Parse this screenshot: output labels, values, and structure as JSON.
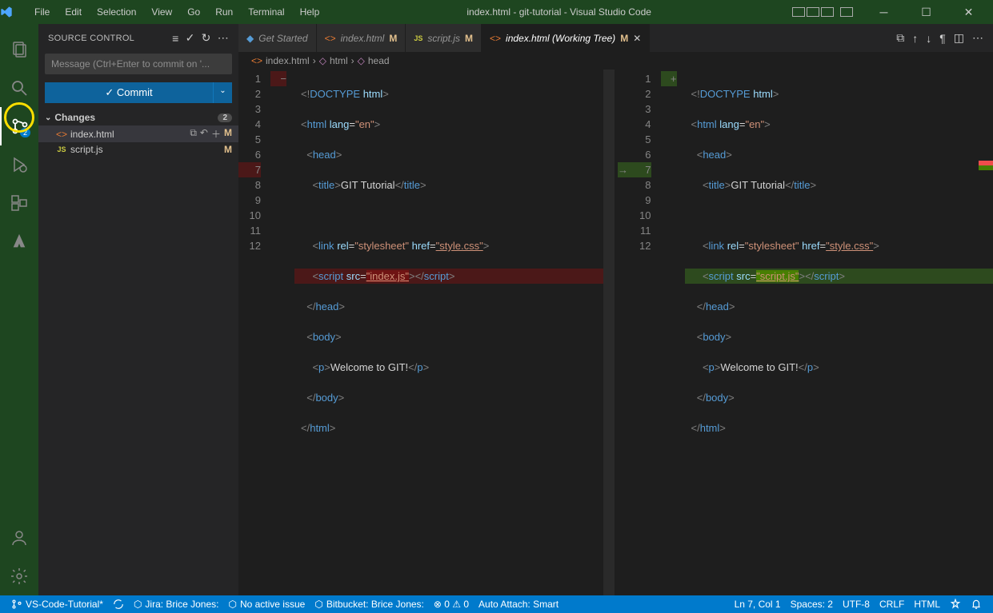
{
  "titlebar": {
    "menus": [
      "File",
      "Edit",
      "Selection",
      "View",
      "Go",
      "Run",
      "Terminal",
      "Help"
    ],
    "title": "index.html - git-tutorial - Visual Studio Code"
  },
  "activitybar": {
    "scm_badge": "2"
  },
  "sidebar": {
    "title": "SOURCE CONTROL",
    "message_placeholder": "Message (Ctrl+Enter to commit on '...",
    "commit_label": "✓ Commit",
    "section": {
      "label": "Changes",
      "count": "2"
    },
    "files": [
      {
        "icon": "<>",
        "iconcls": "html-ic",
        "name": "index.html",
        "status": "M",
        "selected": true
      },
      {
        "icon": "JS",
        "iconcls": "js-ic",
        "name": "script.js",
        "status": "M",
        "selected": false
      }
    ]
  },
  "tabs": [
    {
      "icon": "⚑",
      "iconcls": "t-blue",
      "label": "Get Started",
      "mod": "",
      "active": false
    },
    {
      "icon": "<>",
      "iconcls": "html-ic",
      "label": "index.html",
      "mod": "M",
      "active": false
    },
    {
      "icon": "JS",
      "iconcls": "js-ic",
      "label": "script.js",
      "mod": "M",
      "active": false
    },
    {
      "icon": "<>",
      "iconcls": "html-ic",
      "label": "index.html (Working Tree)",
      "mod": "M",
      "active": true
    }
  ],
  "breadcrumb": {
    "file": "index.html",
    "el1": "html",
    "el2": "head"
  },
  "code_left": {
    "nums": [
      "1",
      "2",
      "3",
      "4",
      "5",
      "6",
      "7",
      "8",
      "9",
      "10",
      "11",
      "12"
    ],
    "marks": [
      "",
      "",
      "",
      "",
      "",
      "",
      "−",
      "",
      "",
      "",
      "",
      ""
    ]
  },
  "code_right": {
    "nums": [
      "1",
      "2",
      "3",
      "4",
      "5",
      "6",
      "7",
      "8",
      "9",
      "10",
      "11",
      "12"
    ],
    "marks": [
      "",
      "",
      "",
      "",
      "",
      "",
      "+",
      "",
      "",
      "",
      "",
      ""
    ]
  },
  "diff": {
    "removed_src": "index.js",
    "added_src": "script.js"
  },
  "statusbar": {
    "branch": "VS-Code-Tutorial*",
    "jira": "Jira: Brice Jones:",
    "issue": "No active issue",
    "bb": "Bitbucket: Brice Jones:",
    "errwarn": "⊗ 0 ⚠ 0",
    "attach": "Auto Attach: Smart",
    "pos": "Ln 7, Col 1",
    "spaces": "Spaces: 2",
    "enc": "UTF-8",
    "eol": "CRLF",
    "lang": "HTML"
  }
}
